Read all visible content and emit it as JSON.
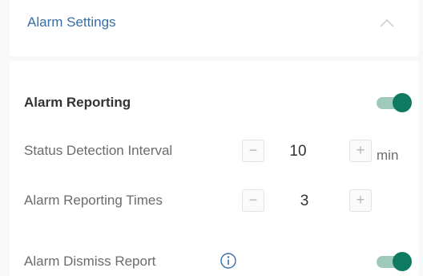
{
  "header": {
    "title": "Alarm Settings",
    "chevron_icon": "chevron-up-icon"
  },
  "alarm_reporting": {
    "label": "Alarm Reporting",
    "enabled": true
  },
  "status_detection_interval": {
    "label": "Status Detection Interval",
    "decrement": "−",
    "value": "10",
    "increment": "+",
    "unit": "min"
  },
  "alarm_reporting_times": {
    "label": "Alarm Reporting Times",
    "decrement": "−",
    "value": "3",
    "increment": "+"
  },
  "alarm_dismiss_report": {
    "label": "Alarm Dismiss Report",
    "info_icon": "info-icon",
    "enabled": true
  },
  "colors": {
    "accent": "#0f7a62",
    "title": "#3a6ea5"
  }
}
